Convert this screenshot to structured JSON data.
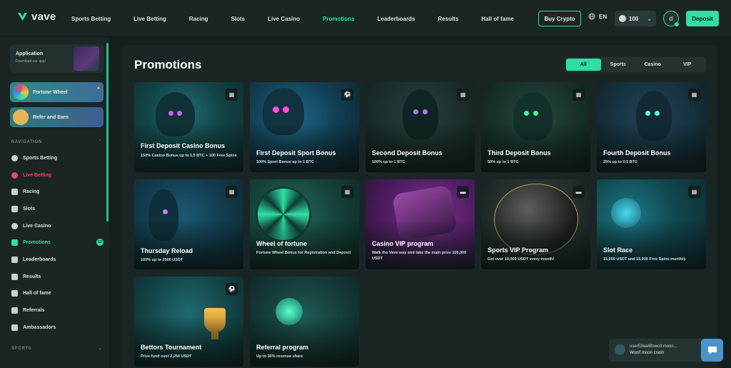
{
  "brand": {
    "name": "vave"
  },
  "nav": {
    "items": [
      "Sports Betting",
      "Live Betting",
      "Racing",
      "Slots",
      "Live Casino",
      "Promotions",
      "Leaderboards",
      "Results",
      "Hall of fame"
    ],
    "active": "Promotions"
  },
  "header": {
    "buy_crypto": "Buy Crypto",
    "language": "EN",
    "balance": "100",
    "avatar_initial": "d",
    "deposit": "Deposit"
  },
  "sidebar": {
    "app_card": {
      "title": "Application",
      "subtitle": "Download our app!"
    },
    "fortune_wheel": "Fortune Wheel",
    "refer_and_earn": "Refer and Earn",
    "navigation_heading": "NAVIGATION",
    "items": [
      {
        "label": "Sports Betting",
        "icon": "soccer-ball-icon"
      },
      {
        "label": "Live Betting",
        "icon": "live-icon"
      },
      {
        "label": "Racing",
        "icon": "horse-icon"
      },
      {
        "label": "Slots",
        "icon": "slots-icon"
      },
      {
        "label": "Live Casino",
        "icon": "casino-chip-icon"
      },
      {
        "label": "Promotions",
        "icon": "promotions-icon",
        "badge": "12"
      },
      {
        "label": "Leaderboards",
        "icon": "leaderboard-icon"
      },
      {
        "label": "Results",
        "icon": "flag-icon"
      },
      {
        "label": "Hall of fame",
        "icon": "trophy-icon"
      },
      {
        "label": "Referrals",
        "icon": "referrals-icon"
      },
      {
        "label": "Ambassadors",
        "icon": "ambassadors-icon"
      }
    ],
    "sports_heading": "SPORTS"
  },
  "main": {
    "title": "Promotions",
    "filters": [
      "All",
      "Sports",
      "Casino",
      "VIP"
    ],
    "active_filter": "All",
    "cards": [
      {
        "title": "First Deposit Casino Bonus",
        "subtitle": "150% Casino Bonus up to 1.5 BTC + 100 Free Spins",
        "tag": "casino"
      },
      {
        "title": "First Deposit Sport Bonus",
        "subtitle": "100% Sport Bonus up to 1 BTC",
        "tag": "sports"
      },
      {
        "title": "Second Deposit Bonus",
        "subtitle": "100% up to 1 BTC",
        "tag": "casino"
      },
      {
        "title": "Third Deposit Bonus",
        "subtitle": "50% up to 1 BTC",
        "tag": "casino"
      },
      {
        "title": "Fourth Deposit Bonus",
        "subtitle": "25% up to 0.5 BTC",
        "tag": "casino"
      },
      {
        "title": "Thursday Reload",
        "subtitle": "100% up to 2500 USDT",
        "tag": "casino"
      },
      {
        "title": "Wheel of fortune",
        "subtitle": "Fortune Wheel Bonus for Registration and Deposit",
        "tag": "casino"
      },
      {
        "title": "Casino VIP program",
        "subtitle": "Walk the Vave way and take the main prize 100,000 USDT",
        "tag": "vip"
      },
      {
        "title": "Sports VIP Program",
        "subtitle": "Get over 10,000 USDT every month!",
        "tag": "vip"
      },
      {
        "title": "Slot Race",
        "subtitle": "15,000 USDT and 15,000 Free Spins monthly",
        "tag": "casino"
      },
      {
        "title": "Bettors Tournament",
        "subtitle": "Prize fund over 2,250 USDT",
        "tag": "sports"
      },
      {
        "title": "Referral program",
        "subtitle": "Up to 30% revenue share",
        "tag": ""
      }
    ]
  },
  "chat": {
    "user": "user53aa48swoll moon...",
    "message": "Woolf moon crash"
  },
  "colors": {
    "accent": "#2ee0a6",
    "background": "#14201f",
    "live": "#e84a5f"
  }
}
